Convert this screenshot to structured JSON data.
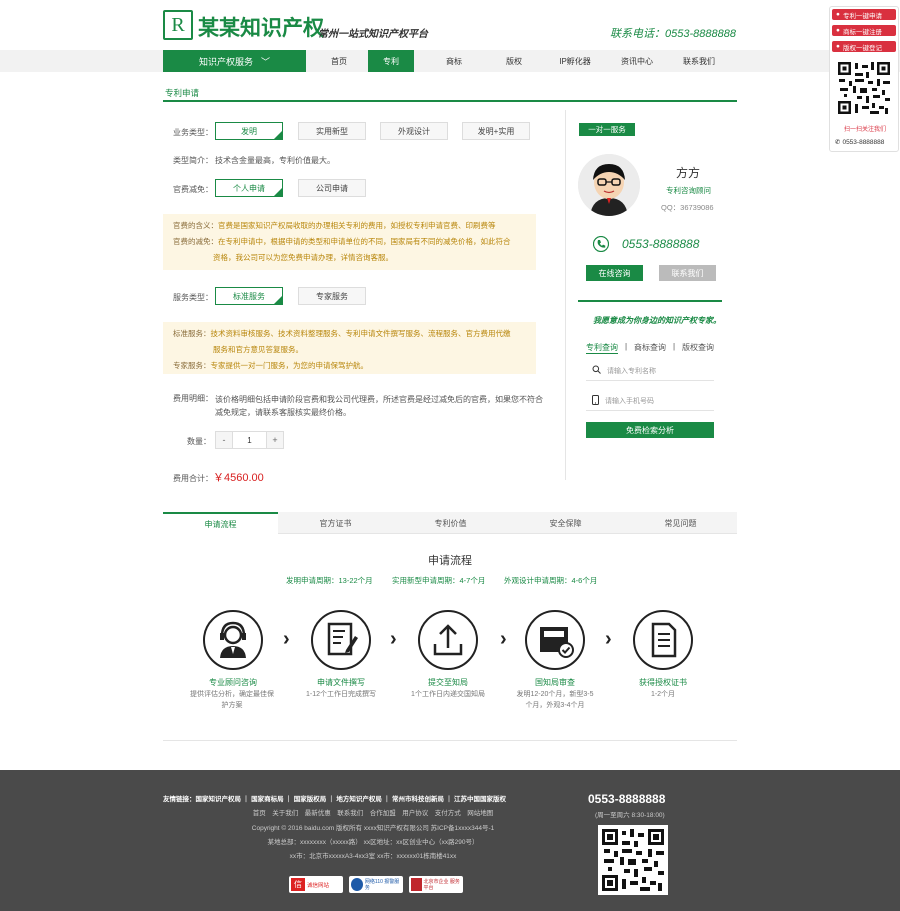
{
  "header": {
    "logo_letter": "R",
    "logo_text": "某某知识产权",
    "slogan": "常州一站式知识产权平台",
    "phone": "联系电话：0553-8888888"
  },
  "nav": {
    "service_label": "知识产权服务",
    "items": [
      "首页",
      "专利",
      "商标",
      "版权",
      "IP孵化器",
      "资讯中心",
      "联系我们"
    ],
    "active_index": 1
  },
  "breadcrumb": "专利申请",
  "form": {
    "business_type_label": "业务类型：",
    "business_types": [
      "发明",
      "实用新型",
      "外观设计",
      "发明+实用"
    ],
    "intro_label": "类型简介：",
    "intro_text": "技术含金量最高，专利价值最大。",
    "fee_reduce_label": "官费减免：",
    "fee_reduce_options": [
      "个人申请",
      "公司申请"
    ],
    "note1": {
      "k1": "官费的含义：",
      "v1": "官费是国家知识产权局收取的办理相关专利的费用，如授权专利申请官费、印刷费等",
      "k2": "官费的减免：",
      "v2": "在专利申请中，根据申请的类型和申请单位的不同，国家局有不同的减免价格，如此符合",
      "v3": "资格，我公司可以为您免费申请办理，详情咨询客服。"
    },
    "service_type_label": "服务类型：",
    "service_types": [
      "标准服务",
      "专家服务"
    ],
    "note2": {
      "k1": "标准服务：",
      "v1": "技术资料审核服务、技术资料整理服务、专利申请文件撰写服务、流程服务、官方费用代缴",
      "v2": "服务和官方意见答复服务。",
      "k2": "专家服务：",
      "v3": "专家提供一对一门服务，为您的申请保驾护航。"
    },
    "fee_desc_label": "费用明细：",
    "fee_desc_1": "该价格明细包括申请阶段官费和我公司代理费，所述官费是经过减免后的官费，如果您不符合",
    "fee_desc_2": "减免规定，请联系客服核实最终价格。",
    "quantity_label": "数量：",
    "quantity": "1",
    "minus": "-",
    "plus": "+",
    "total_label": "费用合计：",
    "total_value": "￥4560.00"
  },
  "consultant": {
    "badge": "一对一服务",
    "name": "方方",
    "role": "专利咨询顾问",
    "qq": "QQ：36739086",
    "phone": "0553-8888888",
    "btn_online": "在线咨询",
    "btn_contact": "联系我们",
    "tagline": "我愿意成为你身边的知识产权专家。",
    "query_tabs": [
      "专利查询",
      "商标查询",
      "版权查询"
    ],
    "input1_placeholder": "请输入专利名称",
    "input2_placeholder": "请输入手机号码",
    "submit": "免费检索分析"
  },
  "tabs": [
    "申请流程",
    "官方证书",
    "专利价值",
    "安全保障",
    "常见问题"
  ],
  "process": {
    "title": "申请流程",
    "cycles": [
      "发明申请周期：13-22个月",
      "实用新型申请周期：4-7个月",
      "外观设计申请周期：4-6个月"
    ],
    "steps": [
      {
        "name": "专业顾问咨询",
        "desc": "提供评估分析，确定最佳保护方案",
        "icon": "headset-icon"
      },
      {
        "name": "申请文件撰写",
        "desc": "1-12个工作日完成撰写",
        "icon": "document-pen-icon"
      },
      {
        "name": "提交至知局",
        "desc": "1个工作日内递交国知局",
        "icon": "upload-icon"
      },
      {
        "name": "国知局审查",
        "desc": "发明12-20个月，新型3-5个月，外观3-4个月",
        "icon": "inbox-check-icon"
      },
      {
        "name": "获得授权证书",
        "desc": "1-2个月",
        "icon": "certificate-icon"
      }
    ]
  },
  "footer": {
    "links": "友情链接：国家知识产权局 ｜ 国家商标局 ｜ 国家版权局 ｜ 地方知识产权局 ｜ 常州市科技创新局 ｜ 江苏中国国家版权",
    "nav": "首页　关于我们　最新优惠　联系我们　合作加盟　用户协议　支付方式　网站地图",
    "copyright": "Copyright © 2016 baidu.com 版权所有  xxxx知识产权有限公司  苏ICP备1xxxx344号-1",
    "addr1": "某地总部：xxxxxxxx（xxxxx路）  xx区地址：xx区创业中心（xx路290号）",
    "addr2": "xx市：北京市xxxxxA3-4xx3室  xx市：xxxxxx01栋南楼41xx",
    "phone": "0553-8888888",
    "hours": "(周一至周六 8:30-18:00)",
    "badges": [
      "诚信网站",
      "网络110 报警服务",
      "北京市企业 服务平台"
    ]
  },
  "side": {
    "btns": [
      "专利一键申请",
      "商标一键注册",
      "版权一键登记"
    ],
    "scan": "扫一扫关注我们",
    "phone": "0553-8888888"
  }
}
